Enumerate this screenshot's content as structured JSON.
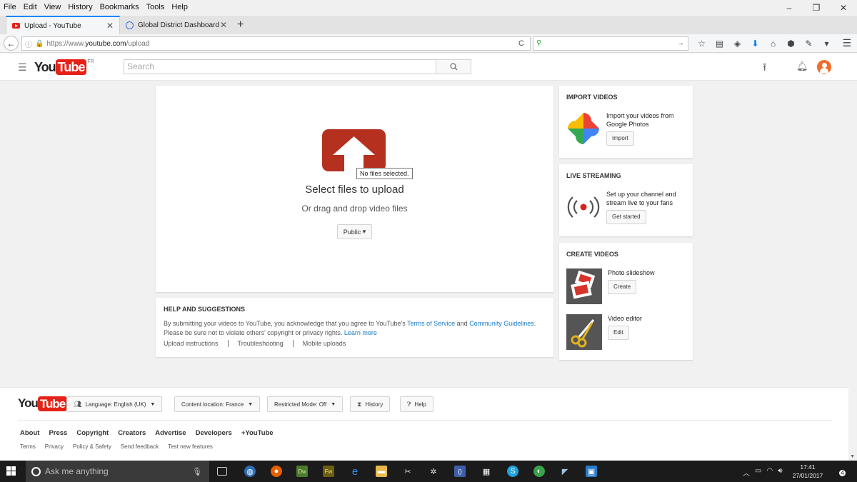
{
  "menubar": {
    "items": [
      {
        "accel": "F",
        "rest": "ile"
      },
      {
        "accel": "E",
        "rest": "dit"
      },
      {
        "accel": "V",
        "rest": "iew"
      },
      {
        "accel": "",
        "pre": "Hi",
        "accel2": "s",
        "rest": "tory"
      },
      {
        "accel": "B",
        "rest": "ookmarks"
      },
      {
        "accel": "T",
        "rest": "ools"
      },
      {
        "accel": "H",
        "rest": "elp"
      }
    ],
    "labels": [
      "File",
      "Edit",
      "View",
      "History",
      "Bookmarks",
      "Tools",
      "Help"
    ]
  },
  "window_controls": {
    "minimize": "–",
    "restore": "❐",
    "close": "✕"
  },
  "tabs": [
    {
      "label": "Upload - YouTube",
      "close": "✕"
    },
    {
      "label": "Global District Dashboard",
      "close": "✕"
    }
  ],
  "new_tab": "+",
  "nav": {
    "back": "←",
    "url_scheme": "https://www.",
    "url_host": "youtube.com",
    "url_path": "/upload",
    "reload": "C"
  },
  "masthead": {
    "logo_you": "You",
    "logo_tube": "Tube",
    "logo_region": "FR",
    "search_placeholder": "Search"
  },
  "upload": {
    "tooltip": "No files selected.",
    "title": "Select files to upload",
    "drag_hint": "Or drag and drop video files",
    "privacy_label": "Public",
    "privacy_caret": "▾"
  },
  "help": {
    "title": "HELP AND SUGGESTIONS",
    "line1_pre": "By submitting your videos to YouTube, you acknowledge that you agree to YouTube's ",
    "tos": "Terms of Service",
    "line1_and": " and ",
    "guidelines": "Community Guidelines",
    "line1_end": ".",
    "line2": "Please be sure not to violate others' copyright or privacy rights. ",
    "learn_more": "Learn more",
    "links": [
      "Upload instructions",
      "Troubleshooting",
      "Mobile uploads"
    ]
  },
  "import": {
    "title": "IMPORT VIDEOS",
    "text": "Import your videos from Google Photos",
    "button": "Import"
  },
  "live": {
    "title": "LIVE STREAMING",
    "text": "Set up your channel and stream live to your fans",
    "button": "Get started"
  },
  "create": {
    "title": "CREATE VIDEOS",
    "slideshow": "Photo slideshow",
    "slideshow_btn": "Create",
    "editor": "Video editor",
    "editor_btn": "Edit"
  },
  "footer": {
    "logo_you": "You",
    "logo_tube": "Tube",
    "language": "Language: English (UK)",
    "location": "Content location: France",
    "restricted": "Restricted Mode: Off",
    "history": "History",
    "help": "Help",
    "primary_links": [
      "About",
      "Press",
      "Copyright",
      "Creators",
      "Advertise",
      "Developers",
      "+YouTube"
    ],
    "secondary_links": [
      "Terms",
      "Privacy",
      "Policy & Safety",
      "Send feedback",
      "Test new features"
    ]
  },
  "taskbar": {
    "search_placeholder": "Ask me anything",
    "time": "17:41",
    "date": "27/01/2017",
    "notifications": "4"
  },
  "colors": {
    "youtube_red": "#e62117",
    "upload_arrow": "#b5301f",
    "link": "#167ac6",
    "taskbar": "#1b1b1b"
  }
}
